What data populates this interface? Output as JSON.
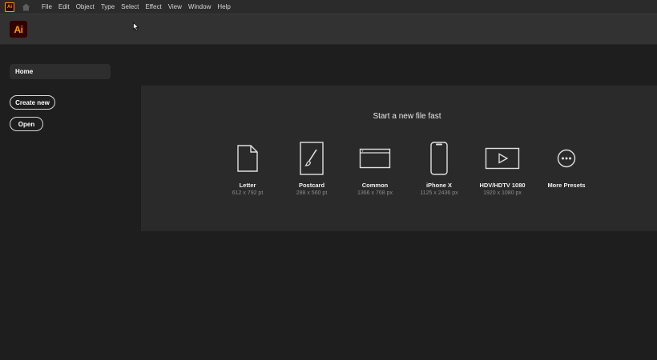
{
  "app": {
    "logo_text": "Ai",
    "menu_logo_text": "Ai",
    "brand_color": "#ff9a00",
    "brand_bg": "#330000"
  },
  "menu": {
    "items": [
      "File",
      "Edit",
      "Object",
      "Type",
      "Select",
      "Effect",
      "View",
      "Window",
      "Help"
    ]
  },
  "sidebar": {
    "home_label": "Home",
    "create_new_label": "Create new",
    "open_label": "Open"
  },
  "start": {
    "title": "Start a new file fast",
    "presets": [
      {
        "name": "Letter",
        "size": "612 x 792 pt",
        "icon": "letter-icon"
      },
      {
        "name": "Postcard",
        "size": "288 x 560 pt",
        "icon": "postcard-icon"
      },
      {
        "name": "Common",
        "size": "1366 x 768 px",
        "icon": "common-icon"
      },
      {
        "name": "iPhone X",
        "size": "1125 x 2436 px",
        "icon": "iphone-icon"
      },
      {
        "name": "HDV/HDTV 1080",
        "size": "1920 x 1080 px",
        "icon": "hdtv-icon"
      },
      {
        "name": "More Presets",
        "size": "",
        "icon": "more-presets-icon"
      }
    ]
  }
}
